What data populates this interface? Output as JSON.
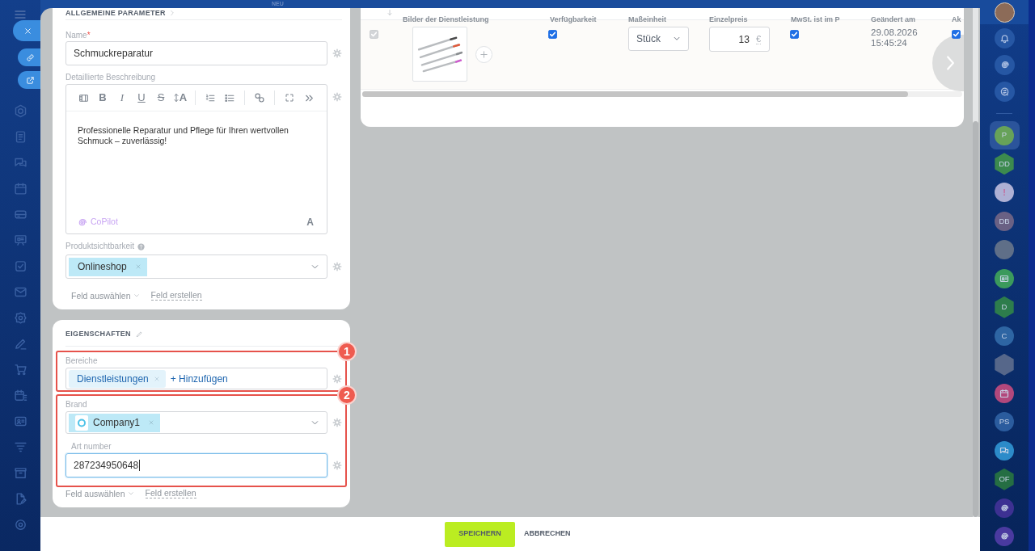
{
  "top_bar": {
    "new_label": "NEU"
  },
  "general": {
    "title": "ALLGEMEINE PARAMETER",
    "name_field": {
      "label": "Name",
      "required_mark": "*",
      "value": "Schmuckreparatur"
    },
    "description": {
      "label": "Detaillierte Beschreibung",
      "toolbar_letters": [
        "B",
        "I",
        "U",
        "S"
      ],
      "font_size_letter": "A",
      "text": "Professionelle Reparatur und Pflege für Ihren wertvollen Schmuck – zuverlässig!",
      "copilot": "CoPilot",
      "format_letter": "A"
    },
    "visibility": {
      "label": "Produktsichtbarkeit",
      "tags": [
        {
          "text": "Onlineshop"
        }
      ]
    },
    "select_field": "Feld auswählen",
    "create_field": "Feld erstellen"
  },
  "properties": {
    "title": "EIGENSCHAFTEN",
    "callouts": [
      {
        "number": "1",
        "fields": [
          {
            "kind": "tags",
            "label": "Bereiche",
            "tags": [
              {
                "text": "Dienstleistungen"
              }
            ],
            "add": "+ Hinzufügen"
          }
        ]
      },
      {
        "number": "2",
        "fields": [
          {
            "kind": "select",
            "label": "Brand",
            "tags": [
              {
                "text": "Company1",
                "logo": true
              }
            ]
          },
          {
            "kind": "input",
            "label": "Art number",
            "value": "287234950648",
            "focused": true
          }
        ]
      }
    ],
    "select_field": "Feld auswählen",
    "create_field": "Feld erstellen"
  },
  "table": {
    "columns": [
      "Bilder der Dienstleistung",
      "Verfügbarkeit",
      "Maßeinheit",
      "Einzelpreis",
      "MwSt. ist im P",
      "Geändert am",
      "Ak"
    ],
    "rows": [
      {
        "checked": true,
        "disabled": true,
        "available": true,
        "unit": "Stück",
        "price": "13",
        "currency": "€",
        "vat_included": true,
        "changed": "29.08.2026 15:45:24",
        "active": true
      }
    ]
  },
  "actions": {
    "save": "SPEICHERN",
    "cancel": "ABBRECHEN"
  },
  "contacts": [
    {
      "kind": "circle",
      "text": "P",
      "color": "#67a259",
      "selected": true
    },
    {
      "kind": "hexagon",
      "text": "DD",
      "color": "#3c8a4e",
      "selected": false
    },
    {
      "kind": "alert",
      "text": "!",
      "color": "#aeb0d4",
      "selected": false
    },
    {
      "kind": "circle",
      "text": "DB",
      "color": "#6a6184",
      "selected": false
    },
    {
      "kind": "photo",
      "selected": false
    },
    {
      "kind": "card",
      "color": "#3b9a5c",
      "selected": false
    },
    {
      "kind": "hexagon",
      "text": "D",
      "color": "#2d7d4c",
      "selected": false
    },
    {
      "kind": "circle",
      "text": "C",
      "color": "#2e65a3",
      "selected": false
    },
    {
      "kind": "crest",
      "selected": false
    },
    {
      "kind": "calendar",
      "color": "#b2487c",
      "selected": false
    },
    {
      "kind": "circle",
      "text": "PS",
      "color": "#2b5c9e",
      "selected": false
    },
    {
      "kind": "chat",
      "color": "#2c8bc9",
      "selected": false
    },
    {
      "kind": "hexagon",
      "text": "OF",
      "color": "#256e43",
      "selected": false
    },
    {
      "kind": "spiral",
      "color": "#3d3192",
      "selected": false
    },
    {
      "kind": "spiral",
      "color": "#4a3aa0",
      "selected": false
    }
  ]
}
